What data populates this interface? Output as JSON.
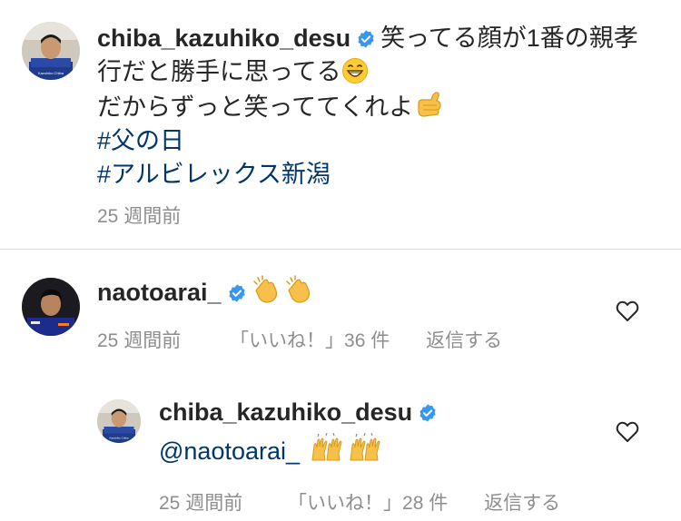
{
  "caption": {
    "username": "chiba_kazuhiko_desu",
    "text_line1": "笑ってる顔が1番の親孝",
    "text_line2": "行だと勝手に思ってる",
    "text_line3": "だからずっと笑っててくれよ",
    "hashtags": [
      "#父の日",
      "#アルビレックス新潟"
    ],
    "time": "25 週間前",
    "avatar_text": "Kazuhiko Chiba"
  },
  "comments": [
    {
      "username": "naotoarai_",
      "time": "25 週間前",
      "likes": "「いいね！」36 件",
      "reply": "返信する"
    }
  ],
  "replies": [
    {
      "username": "chiba_kazuhiko_desu",
      "mention": "@naotoarai_",
      "time": "25 週間前",
      "likes": "「いいね！」28 件",
      "reply": "返信する",
      "avatar_text": "Kazuhiko Chiba"
    }
  ],
  "colors": {
    "verified": "#3897f0",
    "hashtag": "#00376b",
    "meta": "#8e8e8e",
    "divider": "#dbdbdb"
  }
}
